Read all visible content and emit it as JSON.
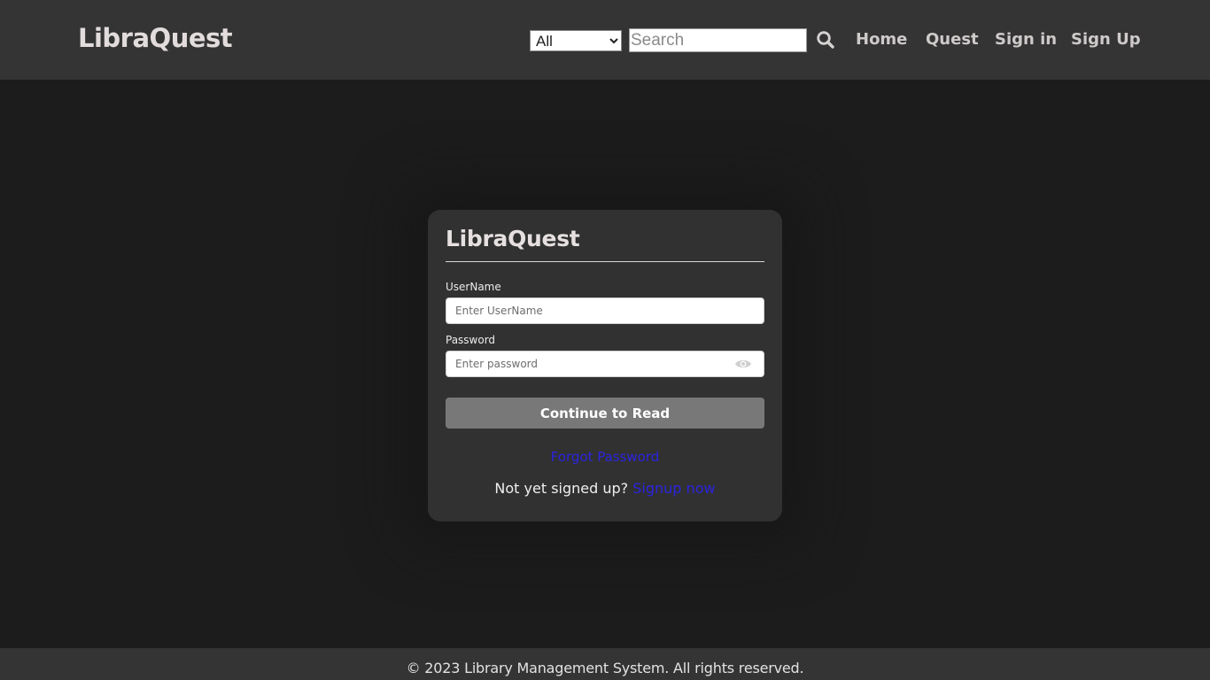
{
  "header": {
    "brand": "LibraQuest",
    "category_select": {
      "selected": "All",
      "options": [
        "All"
      ]
    },
    "search": {
      "placeholder": "Search",
      "value": ""
    },
    "search_icon": "search-icon",
    "nav": [
      {
        "label": "Home"
      },
      {
        "label": "Quest"
      },
      {
        "label": "Sign in"
      },
      {
        "label": "Sign Up"
      }
    ]
  },
  "login": {
    "title": "LibraQuest",
    "username_label": "UserName",
    "username_placeholder": "Enter UserName",
    "password_label": "Password",
    "password_placeholder": "Enter password",
    "password_toggle_icon": "eye-icon",
    "submit_label": "Continue to Read",
    "forgot_label": "Forgot Password",
    "signup_prompt": "Not yet signed up?",
    "signup_link": "Signup now"
  },
  "footer": {
    "text": "© 2023 Library Management System. All rights reserved."
  },
  "colors": {
    "page_bg": "#1c1c1c",
    "bar_bg": "#343434",
    "card_bg": "#313131",
    "button_bg": "#787878",
    "link": "#2c24e0"
  }
}
